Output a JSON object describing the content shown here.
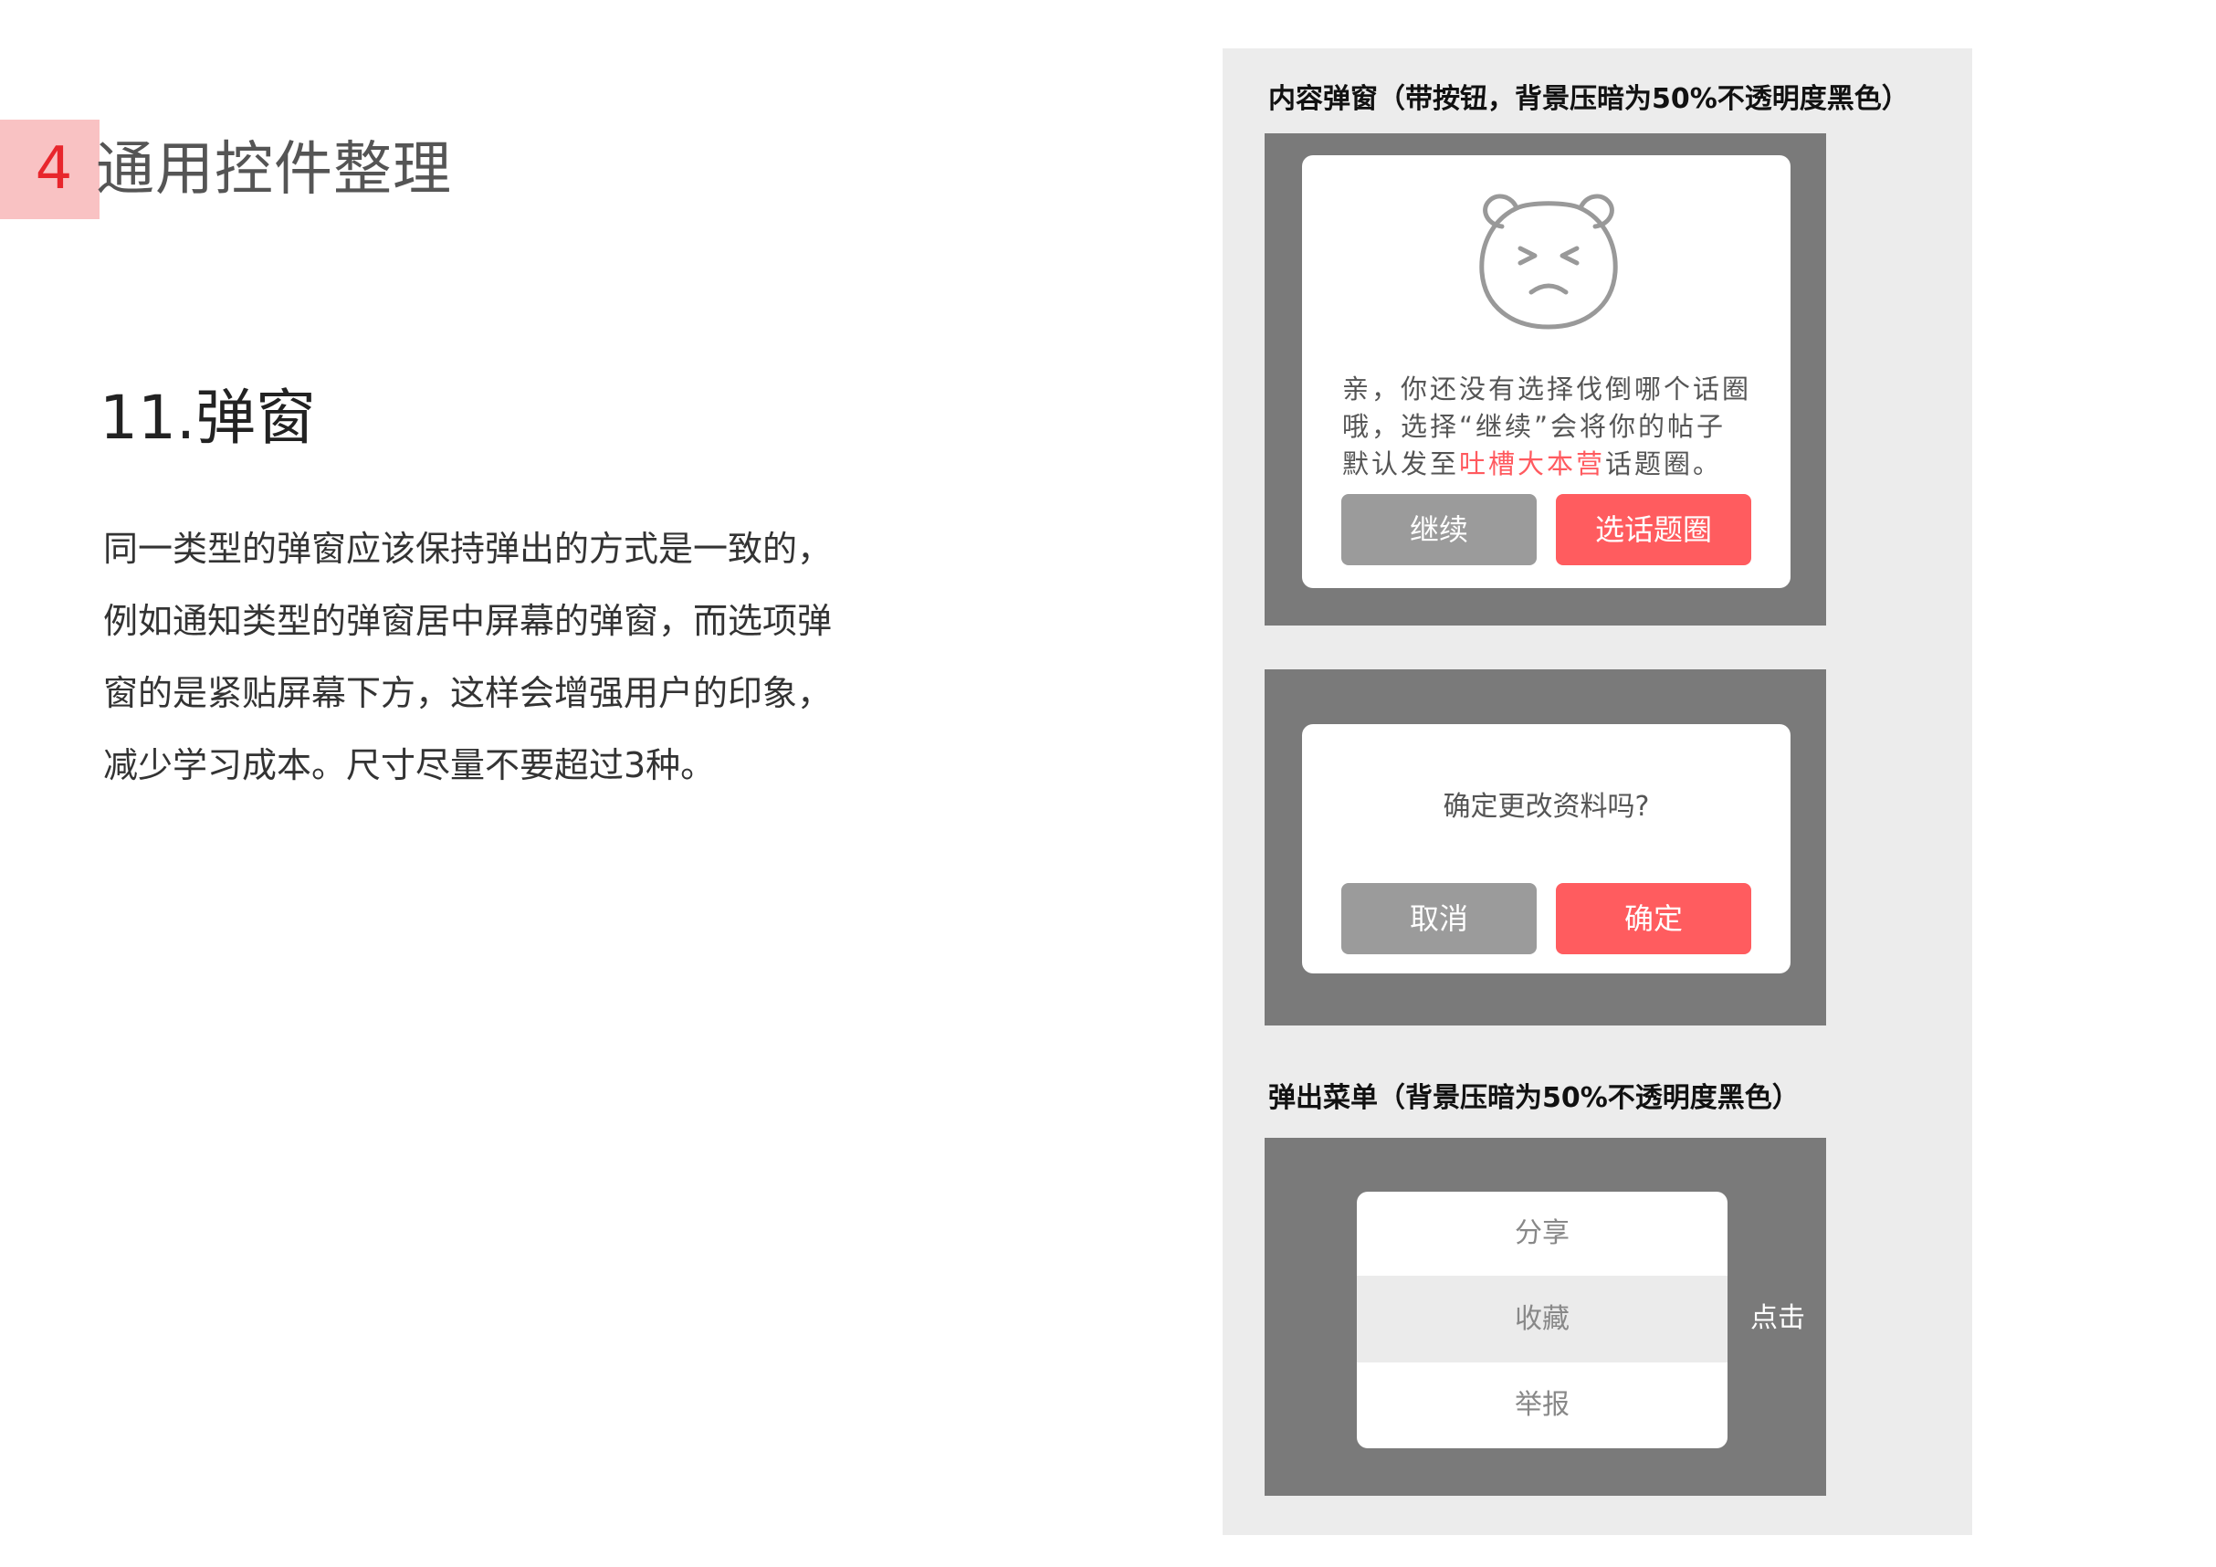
{
  "section": {
    "number": "4",
    "title": "通用控件整理"
  },
  "topic": {
    "title": "11.弹窗"
  },
  "description": {
    "lines": [
      "同一类型的弹窗应该保持弹出的方式是一致的，",
      "例如通知类型的弹窗居中屏幕的弹窗，而选项弹",
      "窗的是紧贴屏幕下方，这样会增强用户的印象，",
      "减少学习成本。尺寸尽量不要超过3种。"
    ]
  },
  "examples": {
    "content_dialog": {
      "caption": "内容弹窗（带按钮，背景压暗为50%不透明度黑色）",
      "message": {
        "line1": "亲，你还没有选择伐倒哪个话圈",
        "line2": "哦，选择“继续”会将你的帖子",
        "line3_prefix": "默认发至",
        "line3_highlight": "吐槽大本营",
        "line3_suffix": "话题圈。"
      },
      "continue_label": "继续",
      "choose_topic_label": "选话题圈",
      "icon": "sad-bear-icon"
    },
    "confirm_dialog": {
      "question": "确定更改资料吗?",
      "cancel_label": "取消",
      "confirm_label": "确定"
    },
    "popup_menu": {
      "caption": "弹出菜单（背景压暗为50%不透明度黑色）",
      "items": [
        "分享",
        "收藏",
        "举报"
      ],
      "active_index": 1,
      "tap_hint": "点击"
    }
  },
  "colors": {
    "accent_red": "#ff5c5f",
    "badge_bg": "#f9c2c3",
    "badge_text": "#e8262c",
    "overlay": "#7a7a7a",
    "panel_bg": "#ececec",
    "neutral_button": "#9b9b9b"
  }
}
